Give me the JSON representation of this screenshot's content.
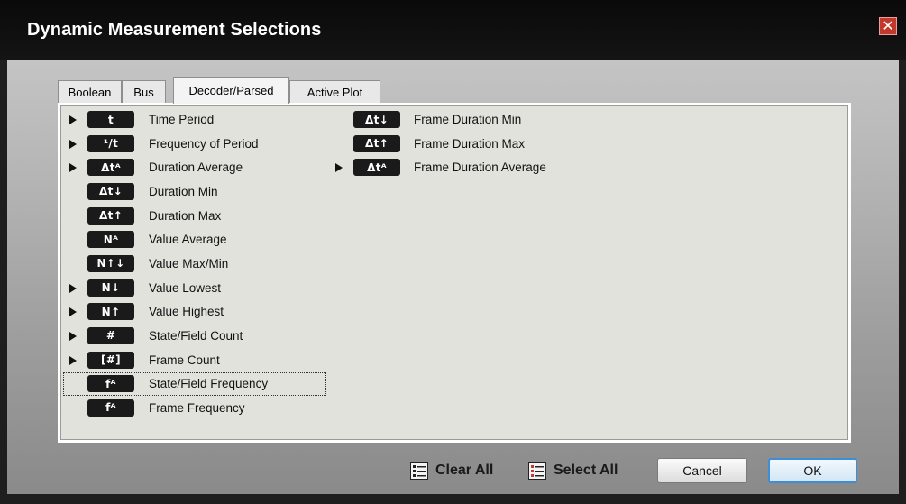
{
  "window": {
    "title": "Dynamic Measurement Selections",
    "close_glyph": "✕"
  },
  "tabs": [
    {
      "label": "Boolean",
      "active": false
    },
    {
      "label": "Bus",
      "active": false
    },
    {
      "label": "Decoder/Parsed",
      "active": true
    },
    {
      "label": "Active Plot",
      "active": false
    }
  ],
  "left_column": [
    {
      "badge": "t",
      "label": "Time Period",
      "has_arrow": true
    },
    {
      "badge": "¹/t",
      "label": "Frequency of Period",
      "has_arrow": true
    },
    {
      "badge": "Δtᴬ",
      "label": "Duration Average",
      "has_arrow": true
    },
    {
      "badge": "Δt↓",
      "label": "Duration Min",
      "has_arrow": false
    },
    {
      "badge": "Δt↑",
      "label": "Duration Max",
      "has_arrow": false
    },
    {
      "badge": "Nᴬ",
      "label": "Value Average",
      "has_arrow": false
    },
    {
      "badge": "N↑↓",
      "label": "Value Max/Min",
      "has_arrow": false
    },
    {
      "badge": "N↓",
      "label": "Value Lowest",
      "has_arrow": true
    },
    {
      "badge": "N↑",
      "label": "Value Highest",
      "has_arrow": true
    },
    {
      "badge": "#",
      "label": "State/Field Count",
      "has_arrow": true
    },
    {
      "badge": "[#]",
      "label": "Frame Count",
      "has_arrow": true
    },
    {
      "badge": "fᴬ",
      "label": "State/Field Frequency",
      "has_arrow": false,
      "focused": true
    },
    {
      "badge": "fᴬ",
      "label": "Frame Frequency",
      "has_arrow": false
    }
  ],
  "right_column": [
    {
      "badge": "Δt↓",
      "label": "Frame Duration Min",
      "has_arrow": false
    },
    {
      "badge": "Δt↑",
      "label": "Frame Duration Max",
      "has_arrow": false
    },
    {
      "badge": "Δtᴬ",
      "label": "Frame Duration Average",
      "has_arrow": true
    }
  ],
  "footer": {
    "clear_all": "Clear All",
    "select_all": "Select All",
    "cancel": "Cancel",
    "ok": "OK"
  },
  "colors": {
    "accent": "#3d8ed6",
    "badge_bg": "#1a1a1a",
    "close_bg": "#c0392b"
  }
}
